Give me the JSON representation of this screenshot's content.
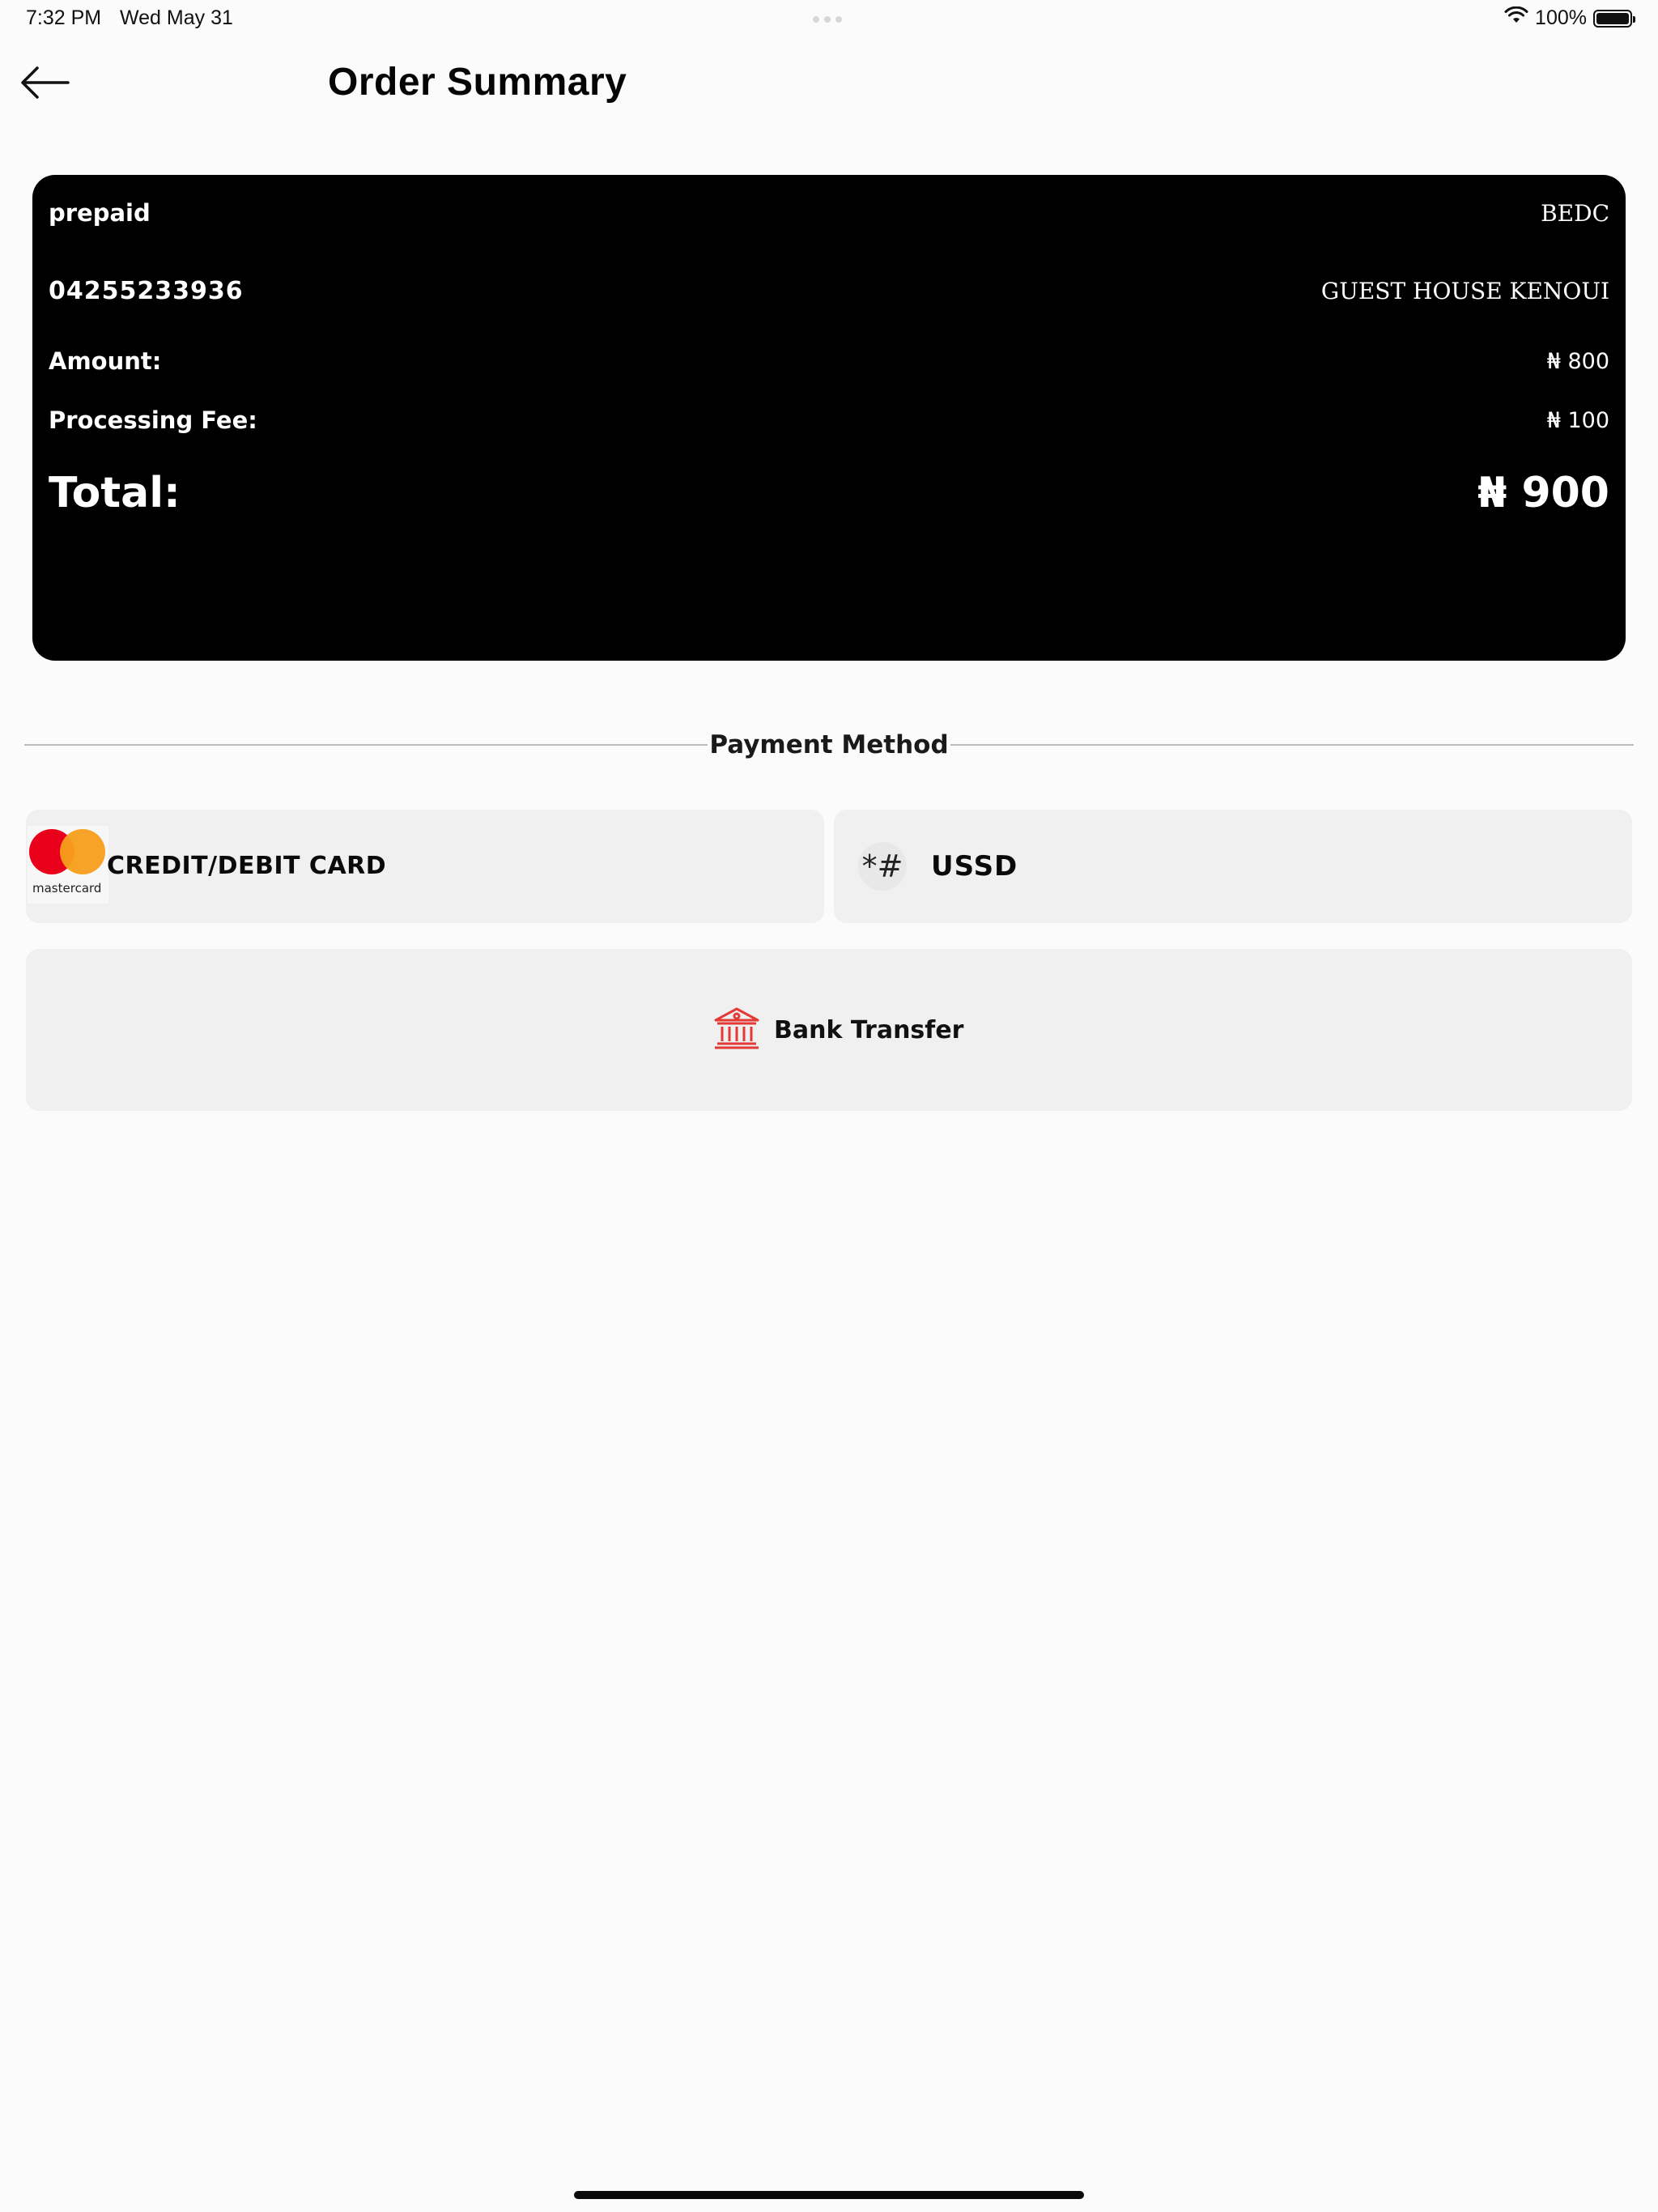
{
  "status_bar": {
    "time": "7:32 PM",
    "date": "Wed May 31",
    "battery_percent": "100%",
    "icons": [
      "wifi-icon",
      "battery-icon"
    ]
  },
  "header": {
    "back_icon": "arrow-left-icon",
    "title": "Order Summary"
  },
  "summary": {
    "meter_type": "prepaid",
    "provider": "BEDC",
    "meter_number": "04255233936",
    "customer_name": "GUEST HOUSE KENOUI",
    "amount_label": "Amount:",
    "amount_value": "₦ 800",
    "fee_label": "Processing Fee:",
    "fee_value": "₦ 100",
    "total_label": "Total:",
    "total_value": "₦ 900"
  },
  "payment": {
    "section_label": "Payment Method",
    "options": {
      "card": {
        "label": "CREDIT/DEBIT CARD",
        "logo_text": "mastercard",
        "icon": "mastercard-icon"
      },
      "ussd": {
        "label": "USSD",
        "icon_text": "*#",
        "icon": "ussd-icon"
      },
      "bank": {
        "label": "Bank Transfer",
        "icon": "bank-icon"
      }
    }
  },
  "colors": {
    "background": "#fbfbfb",
    "card_bg": "#000000",
    "option_bg": "#f0f0f0",
    "bank_icon": "#e53935",
    "mc_red": "#eb001b",
    "mc_orange": "#f79e1b"
  }
}
